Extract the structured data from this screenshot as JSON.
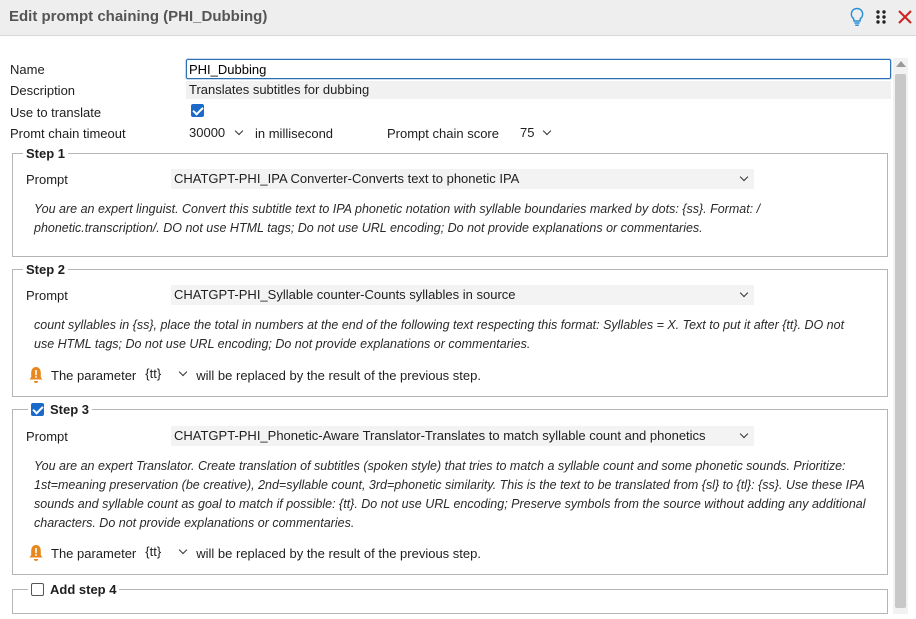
{
  "window": {
    "title": "Edit prompt chaining (PHI_Dubbing)"
  },
  "form": {
    "name_label": "Name",
    "name_value": "PHI_Dubbing",
    "description_label": "Description",
    "description_value": "Translates subtitles for dubbing",
    "use_to_translate_label": "Use to translate",
    "use_to_translate_checked": true,
    "timeout_label": "Promt chain timeout",
    "timeout_value": "30000",
    "timeout_unit": "in millisecond",
    "score_label": "Prompt chain score",
    "score_value": "75"
  },
  "steps": [
    {
      "title": "Step 1",
      "prompt_label": "Prompt",
      "prompt_value": "CHATGPT-PHI_IPA Converter-Converts text to phonetic IPA",
      "prompt_text": "You are an expert linguist. Convert this subtitle text to IPA phonetic notation with syllable boundaries marked by dots: {ss}. Format: / phonetic.transcription/. DO not use HTML tags; Do not use URL encoding; Do not provide explanations or commentaries."
    },
    {
      "title": "Step 2",
      "prompt_label": "Prompt",
      "prompt_value": "CHATGPT-PHI_Syllable counter-Counts syllables in source",
      "prompt_text": "count syllables in {ss}, place the total in numbers at the end of the following text respecting this format: Syllables = X. Text to put it after {tt}. DO not use HTML tags; Do not use URL encoding; Do not provide explanations or commentaries.",
      "param_prefix": "The parameter",
      "param_value": "{tt}",
      "param_suffix": "will be replaced by the result of the previous step."
    },
    {
      "title": "Step 3",
      "checked": true,
      "prompt_label": "Prompt",
      "prompt_value": "CHATGPT-PHI_Phonetic-Aware Translator-Translates to match syllable count and phonetics",
      "prompt_text": "You are an expert Translator. Create translation of subtitles (spoken style) that tries to match a syllable count and some phonetic sounds. Prioritize: 1st=meaning preservation (be creative), 2nd=syllable count, 3rd=phonetic similarity. This is the text to be translated from {sl} to {tl}: {ss}. Use these IPA sounds and syllable count as goal to match if possible: {tt}. Do not use URL encoding; Preserve symbols from the source without adding any additional characters. Do not provide explanations or commentaries.",
      "param_prefix": "The parameter",
      "param_value": "{tt}",
      "param_suffix": "will be replaced by the result of the previous step."
    },
    {
      "title": "Add step 4",
      "checked": false
    }
  ],
  "colors": {
    "accent": "#1b6ac9",
    "close": "#cc2222",
    "lightbulb": "#2b8fd6",
    "warning": "#e8871e"
  }
}
